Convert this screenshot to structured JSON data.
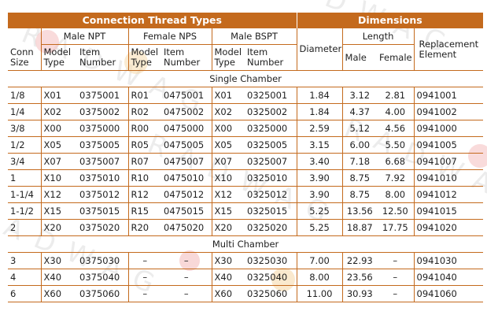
{
  "header": {
    "connection_thread_types": "Connection Thread Types",
    "dimensions": "Dimensions"
  },
  "subheaders": {
    "male_npt": "Male NPT",
    "female_nps": "Female NPS",
    "male_bspt": "Male BSPT",
    "diameter": "Diameter",
    "length": "Length",
    "replacement_element": "Replacement Element"
  },
  "columns": {
    "conn_size": "Conn Size",
    "model_type": "Model Type",
    "item_number": "Item Number",
    "male": "Male",
    "female": "Female"
  },
  "sections": {
    "single": "Single Chamber",
    "multi": "Multi Chamber"
  },
  "single_rows": [
    [
      "1/8",
      "X01",
      "0375001",
      "R01",
      "0475001",
      "X01",
      "0325001",
      "1.84",
      "3.12",
      "2.81",
      "0941001"
    ],
    [
      "1/4",
      "X02",
      "0375002",
      "R02",
      "0475002",
      "X02",
      "0325002",
      "1.84",
      "4.37",
      "4.00",
      "0941002"
    ],
    [
      "3/8",
      "X00",
      "0375000",
      "R00",
      "0475000",
      "X00",
      "0325000",
      "2.59",
      "5.12",
      "4.56",
      "0941000"
    ],
    [
      "1/2",
      "X05",
      "0375005",
      "R05",
      "0475005",
      "X05",
      "0325005",
      "3.15",
      "6.00",
      "5.50",
      "0941005"
    ],
    [
      "3/4",
      "X07",
      "0375007",
      "R07",
      "0475007",
      "X07",
      "0325007",
      "3.40",
      "7.18",
      "6.68",
      "0941007"
    ],
    [
      "1",
      "X10",
      "0375010",
      "R10",
      "0475010",
      "X10",
      "0325010",
      "3.90",
      "8.75",
      "7.92",
      "0941010"
    ],
    [
      "1-1/4",
      "X12",
      "0375012",
      "R12",
      "0475012",
      "X12",
      "0325012",
      "3.90",
      "8.75",
      "8.00",
      "0941012"
    ],
    [
      "1-1/2",
      "X15",
      "0375015",
      "R15",
      "0475015",
      "X15",
      "0325015",
      "5.25",
      "13.56",
      "12.50",
      "0941015"
    ],
    [
      "2",
      "X20",
      "0375020",
      "R20",
      "0475020",
      "X20",
      "0325020",
      "5.25",
      "18.87",
      "17.75",
      "0941020"
    ]
  ],
  "multi_rows": [
    [
      "3",
      "X30",
      "0375030",
      "–",
      "–",
      "X30",
      "0325030",
      "7.00",
      "22.93",
      "–",
      "0941030"
    ],
    [
      "4",
      "X40",
      "0375040",
      "–",
      "–",
      "X40",
      "0325040",
      "8.00",
      "23.56",
      "–",
      "0941040"
    ],
    [
      "6",
      "X60",
      "0375060",
      "–",
      "–",
      "X60",
      "0325060",
      "11.00",
      "30.93",
      "–",
      "0941060"
    ]
  ],
  "watermark_text": "RADWAG",
  "colors": {
    "accent": "#c46a1d",
    "header_text": "#ffffff",
    "body_text": "#1f1f1f"
  }
}
